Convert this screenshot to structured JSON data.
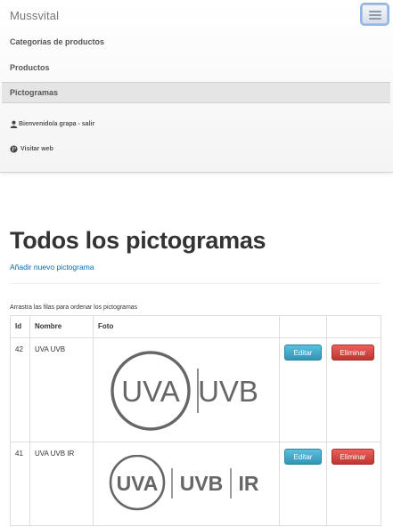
{
  "navbar": {
    "brand": "Mussvital",
    "items": [
      {
        "label": "Categorías de productos"
      },
      {
        "label": "Productos"
      },
      {
        "label": "Pictogramas"
      }
    ],
    "user_link": "Bienvenido/a grapa - salir",
    "visit_link": "Visitar web"
  },
  "main": {
    "title": "Todos los pictogramas",
    "add_link": "Añadir nuevo pictograma",
    "hint": "Arrastra las filas para ordenar los pictogramas"
  },
  "table": {
    "headers": [
      "Id",
      "Nombre",
      "Foto",
      "",
      ""
    ],
    "rows": [
      {
        "id": "42",
        "name": "UVA UVB",
        "logo": [
          "UVA",
          "UVB"
        ],
        "edit": "Editar",
        "delete": "Eliminar"
      },
      {
        "id": "41",
        "name": "UVA UVB IR",
        "logo": [
          "UVA",
          "UVB",
          "IR"
        ],
        "edit": "Editar",
        "delete": "Eliminar"
      }
    ]
  },
  "colors": {
    "link": "#0b67b3",
    "edit_button": "#49afcd",
    "delete_button": "#da4f49",
    "logo_gray": "#666666"
  },
  "icons": {
    "user": "user-icon",
    "globe": "globe-icon",
    "menu": "menu-icon"
  }
}
